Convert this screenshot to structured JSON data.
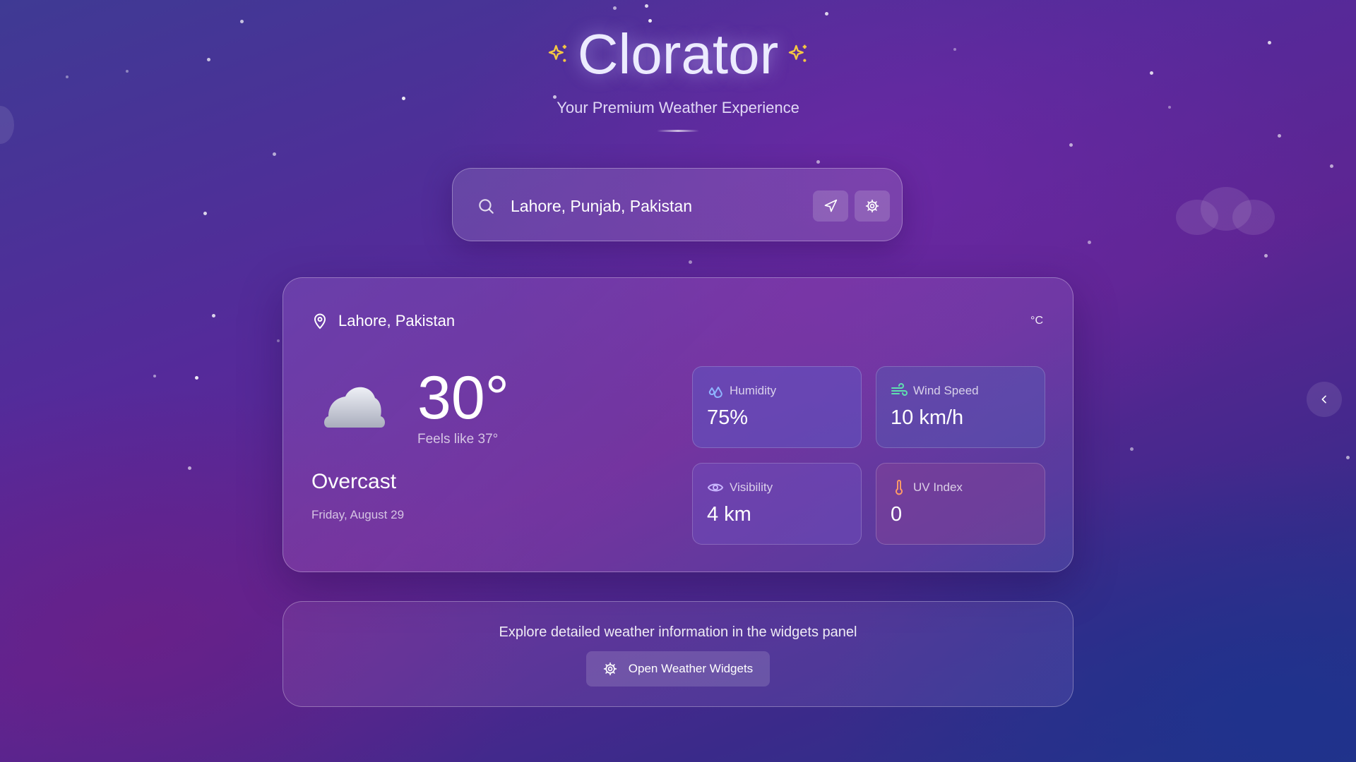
{
  "app": {
    "title": "Clorator",
    "subtitle": "Your Premium Weather Experience"
  },
  "search": {
    "value": "Lahore, Punjab, Pakistan"
  },
  "current": {
    "location": "Lahore, Pakistan",
    "unit": "°C",
    "temperature": "30°",
    "feels_like": "Feels like 37°",
    "condition": "Overcast",
    "date": "Friday, August 29",
    "weather_icon": "cloud-icon"
  },
  "stats": [
    {
      "label": "Humidity",
      "value": "75%",
      "icon": "droplets-icon",
      "icon_color": "#8fb4ff"
    },
    {
      "label": "Wind Speed",
      "value": "10 km/h",
      "icon": "wind-icon",
      "icon_color": "#5fe0b0"
    },
    {
      "label": "Visibility",
      "value": "4 km",
      "icon": "eye-icon",
      "icon_color": "#c9b6ff"
    },
    {
      "label": "UV Index",
      "value": "0",
      "icon": "thermometer-icon",
      "icon_color": "#ff9a66"
    }
  ],
  "explore": {
    "text": "Explore detailed weather information in the widgets panel",
    "button_label": "Open Weather Widgets"
  },
  "colors": {
    "accent_sparkle": "#f5c842"
  }
}
